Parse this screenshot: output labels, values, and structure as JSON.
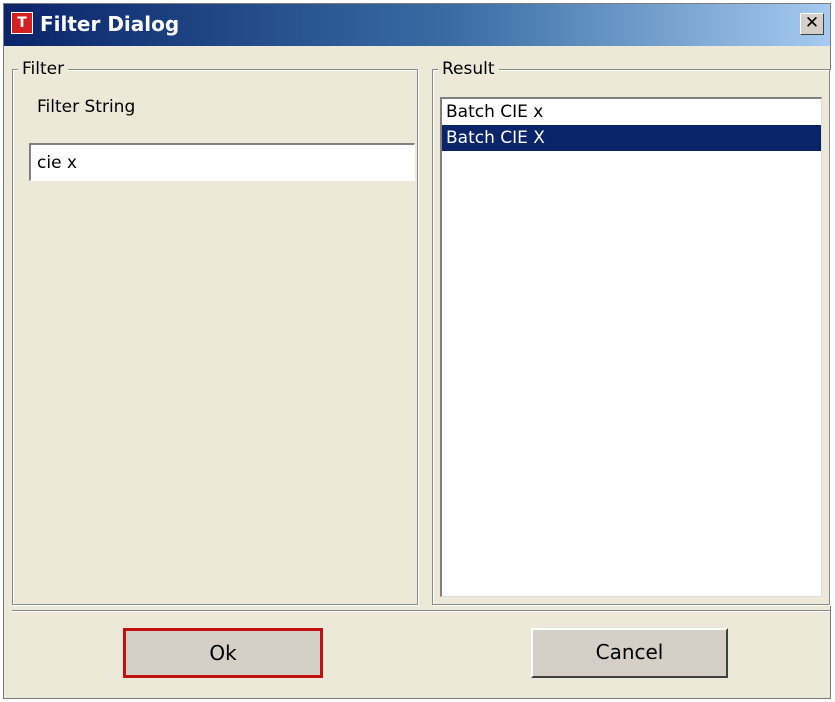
{
  "window": {
    "title": "Filter Dialog",
    "app_icon_letter": "T",
    "close_symbol": "✕",
    "close_icon": "close-icon"
  },
  "filter": {
    "group_label": "Filter",
    "field_label": "Filter String",
    "value": "cie x"
  },
  "result": {
    "group_label": "Result",
    "items": [
      {
        "label": "Batch CIE x",
        "selected": false
      },
      {
        "label": "Batch CIE X",
        "selected": true
      }
    ]
  },
  "buttons": {
    "ok_label": "Ok",
    "cancel_label": "Cancel"
  },
  "colors": {
    "titlebar_start": "#0a246a",
    "titlebar_end": "#a6caf0",
    "dialog_background": "#ece9d8",
    "selection": "#0a246a",
    "default_button_border": "#c21010"
  }
}
